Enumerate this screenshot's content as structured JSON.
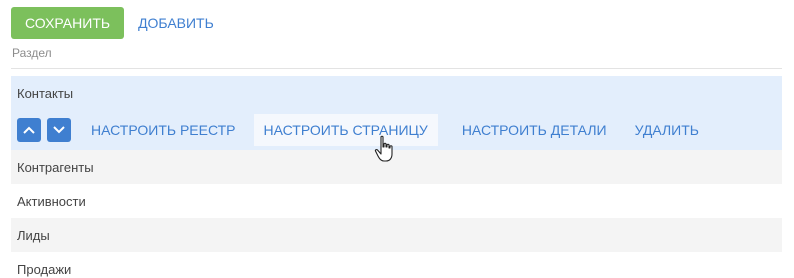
{
  "toolbar": {
    "save_label": "СОХРАНИТЬ",
    "add_label": "ДОБАВИТЬ"
  },
  "section": {
    "caption": "Раздел"
  },
  "list": {
    "selected": "Контакты",
    "actions": {
      "up_icon": "chevron-up-icon",
      "down_icon": "chevron-down-icon",
      "configure_registry": "НАСТРОИТЬ РЕЕСТР",
      "configure_page": "НАСТРОИТЬ СТРАНИЦУ",
      "configure_details": "НАСТРОИТЬ ДЕТАЛИ",
      "delete": "УДАЛИТЬ"
    },
    "items": [
      "Контрагенты",
      "Активности",
      "Лиды",
      "Продажи"
    ]
  },
  "colors": {
    "save_button": "#7cc05c",
    "accent": "#3f7fd0",
    "selected_row": "#e3eefc",
    "alt_row": "#f4f4f4"
  }
}
